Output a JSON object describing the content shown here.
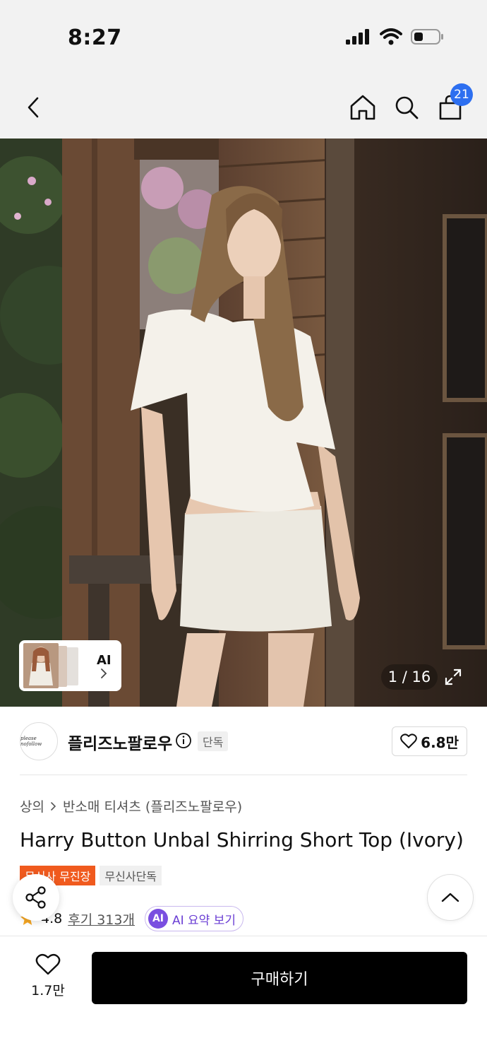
{
  "status_bar": {
    "time": "8:27"
  },
  "header": {
    "cart_count": "21",
    "icons": [
      "back-icon",
      "home-icon",
      "search-icon",
      "cart-icon"
    ]
  },
  "gallery": {
    "counter": "1 / 16",
    "ai_label": "AI"
  },
  "brand": {
    "logo_text": "please nofollow",
    "name": "플리즈노팔로우",
    "tag": "단독",
    "likes": "6.8만"
  },
  "product": {
    "breadcrumb": [
      "상의",
      "반소매 티셔츠 (플리즈노팔로우)"
    ],
    "title": "Harry Button Unbal Shirring Short Top (Ivory)",
    "badges": {
      "primary": "무신사 무진장",
      "secondary": "무신사단독"
    },
    "rating": "4.8",
    "reviews": "후기 313개",
    "ai_summary_icon": "AI",
    "ai_summary": "AI 요약 보기"
  },
  "bottom_bar": {
    "wish_count": "1.7만",
    "buy_label": "구매하기"
  },
  "colors": {
    "accent_blue": "#2d6ff0",
    "badge_orange": "#f05a1e",
    "ai_purple": "#7a4fe0",
    "star": "#f5a623"
  }
}
